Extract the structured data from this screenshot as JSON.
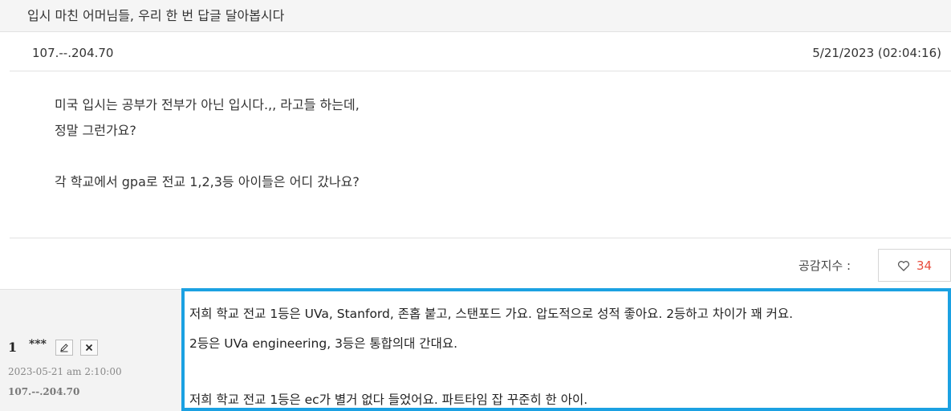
{
  "post": {
    "title": "입시 마친 어머님들, 우리 한 번 답글 달아봅시다",
    "ip": "107.--.204.70",
    "datetime": "5/21/2023 (02:04:16)",
    "body_lines": [
      "미국 입시는 공부가 전부가 아닌 입시다.,, 라고들 하는데,",
      "정말 그런가요?",
      "",
      "각 학교에서 gpa로 전교 1,2,3등 아이들은 어디 갔나요?"
    ]
  },
  "likes": {
    "label": "공감지수 :",
    "count": "34",
    "icon": "heart-outline-icon",
    "count_color": "#e84c3d"
  },
  "comment": {
    "number": "1",
    "author": "***",
    "edit_icon": "pencil-icon",
    "delete_icon": "close-icon",
    "date": "2023-05-21 am 2:10:00",
    "ip": "107.--.204.70",
    "lines": [
      "저희 학교 전교 1등은 UVa, Stanford, 존홉 붙고, 스탠포드 가요. 압도적으로 성적 좋아요. 2등하고 차이가 꽤 커요.",
      "2등은 UVa engineering, 3등은 통합의대 간대요.",
      "",
      "저희 학교 전교 1등은 ec가 별거 없다 들었어요. 파트타임 잡 꾸준히 한 아이."
    ]
  },
  "colors": {
    "highlight_border": "#1ba1e2",
    "title_bg": "#f5f5f5"
  }
}
